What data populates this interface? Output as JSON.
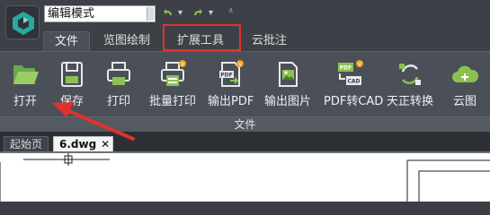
{
  "app": {
    "mode_select": {
      "value": "编辑模式"
    }
  },
  "ribbon": {
    "tabs": [
      {
        "label": "文件",
        "active": true
      },
      {
        "label": "览图绘制"
      },
      {
        "label": "扩展工具",
        "highlighted": true
      },
      {
        "label": "云批注"
      }
    ],
    "buttons": [
      {
        "label": "打开",
        "icon": "folder-open-icon"
      },
      {
        "label": "保存",
        "icon": "floppy-save-icon"
      },
      {
        "label": "打印",
        "icon": "printer-icon"
      },
      {
        "label": "批量打印",
        "icon": "batch-print-icon",
        "vip": true
      },
      {
        "label": "输出PDF",
        "icon": "pdf-export-icon",
        "vip": true
      },
      {
        "label": "输出图片",
        "icon": "image-export-icon"
      },
      {
        "label": "PDF转CAD",
        "icon": "pdf-to-cad-icon",
        "vip": true
      },
      {
        "label": "天正转换",
        "icon": "tangent-convert-icon"
      },
      {
        "label": "云图",
        "icon": "cloud-icon"
      }
    ],
    "group_label": "文件"
  },
  "doc_tabs": [
    {
      "label": "起始页"
    },
    {
      "label": "6.dwg",
      "active": true
    }
  ],
  "colors": {
    "accent_red": "#e0322c",
    "icon_green": "#8cc152",
    "vip_badge": "#f0a020"
  }
}
